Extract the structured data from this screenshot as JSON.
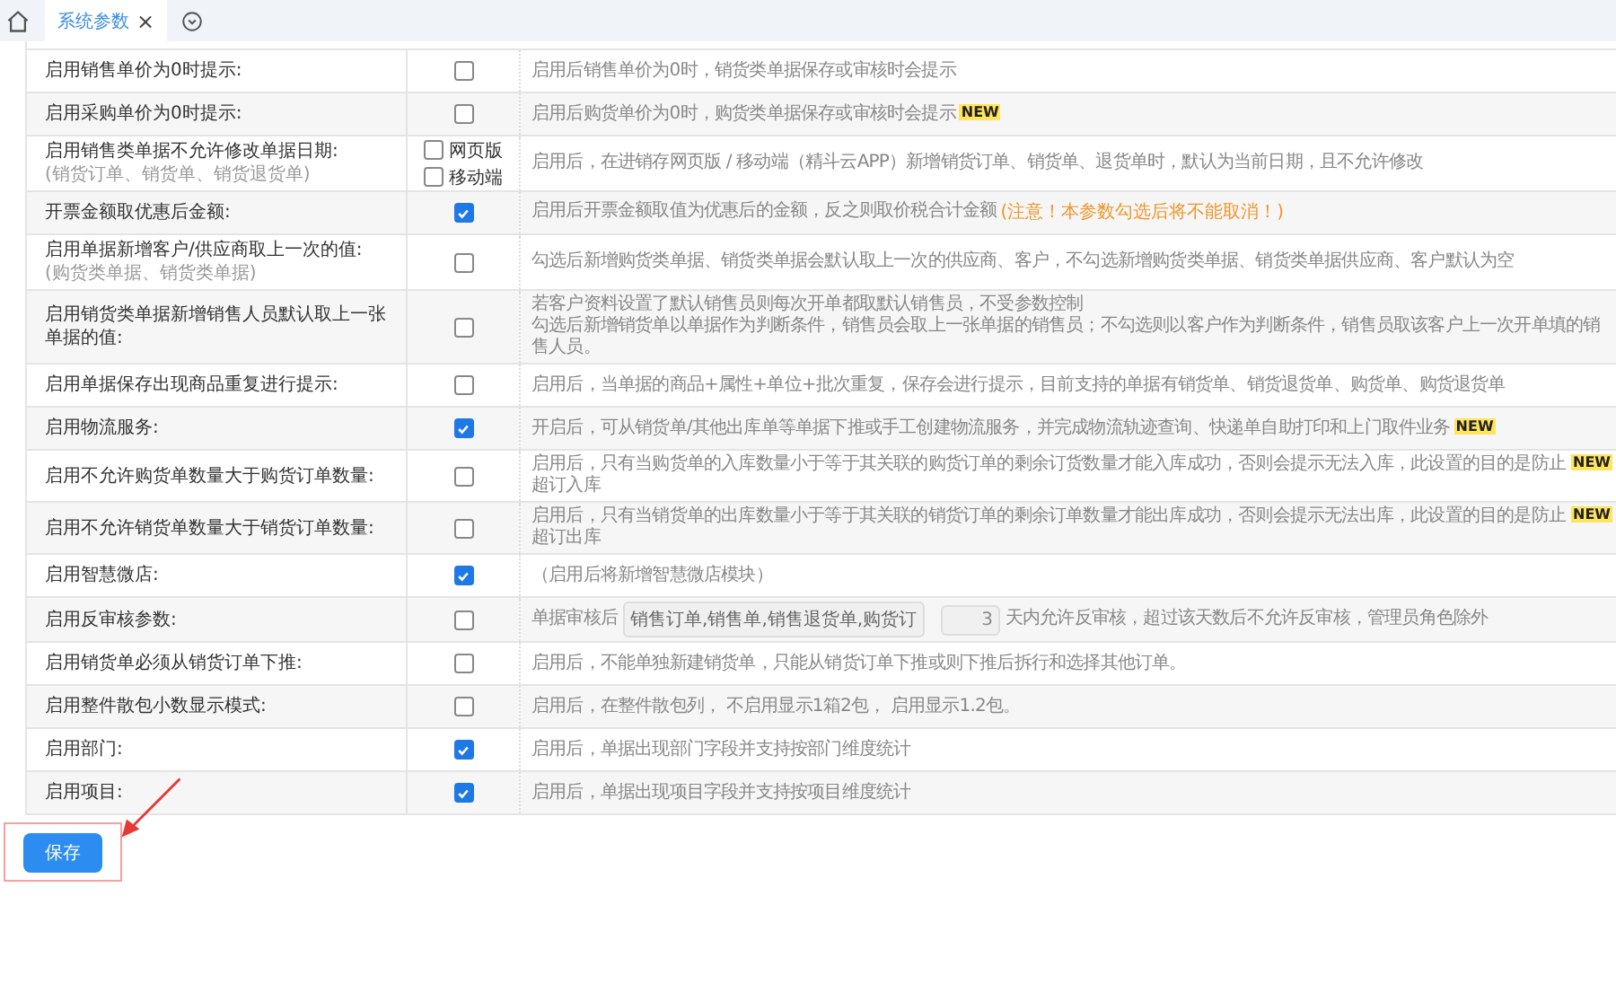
{
  "tabs": [
    {
      "label": "系统参数",
      "selected": true,
      "close": "×"
    }
  ],
  "rows": [
    {
      "label": "启用销售单价为0时提示:",
      "control": {
        "kind": "checkbox",
        "checked": false
      },
      "desc": {
        "kind": "text",
        "lines": [
          "启用后销售单价为0时，销货类单据保存或审核时会提示"
        ]
      }
    },
    {
      "label": "启用采购单价为0时提示:",
      "control": {
        "kind": "checkbox",
        "checked": false
      },
      "desc": {
        "kind": "text",
        "lines": [
          "启用后购货单价为0时，购货类单据保存或审核时会提示"
        ],
        "badge": "NEW"
      }
    },
    {
      "label": "启用销售类单据不允许修改单据日期:",
      "sublabel": "(销货订单、销货单、销货退货单)",
      "control": {
        "kind": "checkbox_group",
        "options": [
          {
            "label": "网页版",
            "checked": false
          },
          {
            "label": "移动端",
            "checked": false
          }
        ]
      },
      "desc": {
        "kind": "text",
        "lines": [
          "启用后，在进销存网页版 / 移动端（精斗云APP）新增销货订单、销货单、退货单时，默认为当前日期，且不允许修改"
        ]
      }
    },
    {
      "label": "开票金额取优惠后金额:",
      "control": {
        "kind": "checkbox",
        "checked": true
      },
      "desc": {
        "kind": "text",
        "lines": [
          "启用后开票金额取值为优惠后的金额，反之则取价税合计金额"
        ],
        "note": "(注意！本参数勾选后将不能取消！)"
      }
    },
    {
      "label": "启用单据新增客户/供应商取上一次的值:",
      "sublabel": "(购货类单据、销货类单据)",
      "control": {
        "kind": "checkbox",
        "checked": false
      },
      "desc": {
        "kind": "text",
        "lines": [
          "勾选后新增购货类单据、销货类单据会默认取上一次的供应商、客户，不勾选新增购货类单据、销货类单据供应商、客户默认为空"
        ]
      }
    },
    {
      "label": "启用销货类单据新增销售人员默认取上一张单据的值:",
      "control": {
        "kind": "checkbox",
        "checked": false
      },
      "desc": {
        "kind": "text",
        "lines": [
          "若客户资料设置了默认销售员则每次开单都取默认销售员，不受参数控制",
          "勾选后新增销货单以单据作为判断条件，销售员会取上一张单据的销售员；不勾选则以客户作为判断条件，销售员取该客户上一次开单填的销售人员。"
        ]
      }
    },
    {
      "label": "启用单据保存出现商品重复进行提示:",
      "control": {
        "kind": "checkbox",
        "checked": false
      },
      "desc": {
        "kind": "text",
        "lines": [
          "启用后，当单据的商品+属性+单位+批次重复，保存会进行提示，目前支持的单据有销货单、销货退货单、购货单、购货退货单"
        ]
      }
    },
    {
      "label": "启用物流服务:",
      "control": {
        "kind": "checkbox",
        "checked": true
      },
      "desc": {
        "kind": "text",
        "lines": [
          "开启后，可从销货单/其他出库单等单据下推或手工创建物流服务，并完成物流轨迹查询、快递单自助打印和上门取件业务"
        ],
        "badge": "NEW"
      }
    },
    {
      "label": "启用不允许购货单数量大于购货订单数量:",
      "control": {
        "kind": "checkbox",
        "checked": false
      },
      "desc": {
        "kind": "text",
        "lines": [
          "启用后，只有当购货单的入库数量小于等于其关联的购货订单的剩余订货数量才能入库成功，否则会提示无法入库，此设置的目的是防止超订入库"
        ],
        "badge": "NEW"
      }
    },
    {
      "label": "启用不允许销货单数量大于销货订单数量:",
      "control": {
        "kind": "checkbox",
        "checked": false
      },
      "desc": {
        "kind": "text",
        "lines": [
          "启用后，只有当销货单的出库数量小于等于其关联的销货订单的剩余订单数量才能出库成功，否则会提示无法出库，此设置的目的是防止超订出库"
        ],
        "badge": "NEW"
      }
    },
    {
      "label": "启用智慧微店:",
      "control": {
        "kind": "checkbox",
        "checked": true
      },
      "desc": {
        "kind": "text",
        "lines": [
          "（启用后将新增智慧微店模块）"
        ]
      }
    },
    {
      "label": "启用反审核参数:",
      "control": {
        "kind": "checkbox",
        "checked": false
      },
      "desc": {
        "kind": "audit",
        "prefix": "单据审核后",
        "select": "销售订单,销售单,销售退货单,购货订",
        "days": "3",
        "suffix": "天内允许反审核，超过该天数后不允许反审核，管理员角色除外"
      }
    },
    {
      "label": "启用销货单必须从销货订单下推:",
      "control": {
        "kind": "checkbox",
        "checked": false
      },
      "desc": {
        "kind": "text",
        "lines": [
          "启用后，不能单独新建销货单，只能从销货订单下推或则下推后拆行和选择其他订单。"
        ]
      }
    },
    {
      "label": "启用整件散包小数显示模式:",
      "control": {
        "kind": "checkbox",
        "checked": false
      },
      "desc": {
        "kind": "text",
        "lines": [
          "启用后，在整件散包列， 不启用显示1箱2包， 启用显示1.2包。"
        ]
      }
    },
    {
      "label": "启用部门:",
      "control": {
        "kind": "checkbox",
        "checked": true
      },
      "desc": {
        "kind": "text",
        "lines": [
          "启用后，单据出现部门字段并支持按部门维度统计"
        ]
      }
    },
    {
      "label": "启用项目:",
      "control": {
        "kind": "checkbox",
        "checked": true
      },
      "desc": {
        "kind": "text",
        "lines": [
          "启用后，单据出现项目字段并支持按项目维度统计"
        ]
      }
    }
  ],
  "save_button": "保存"
}
